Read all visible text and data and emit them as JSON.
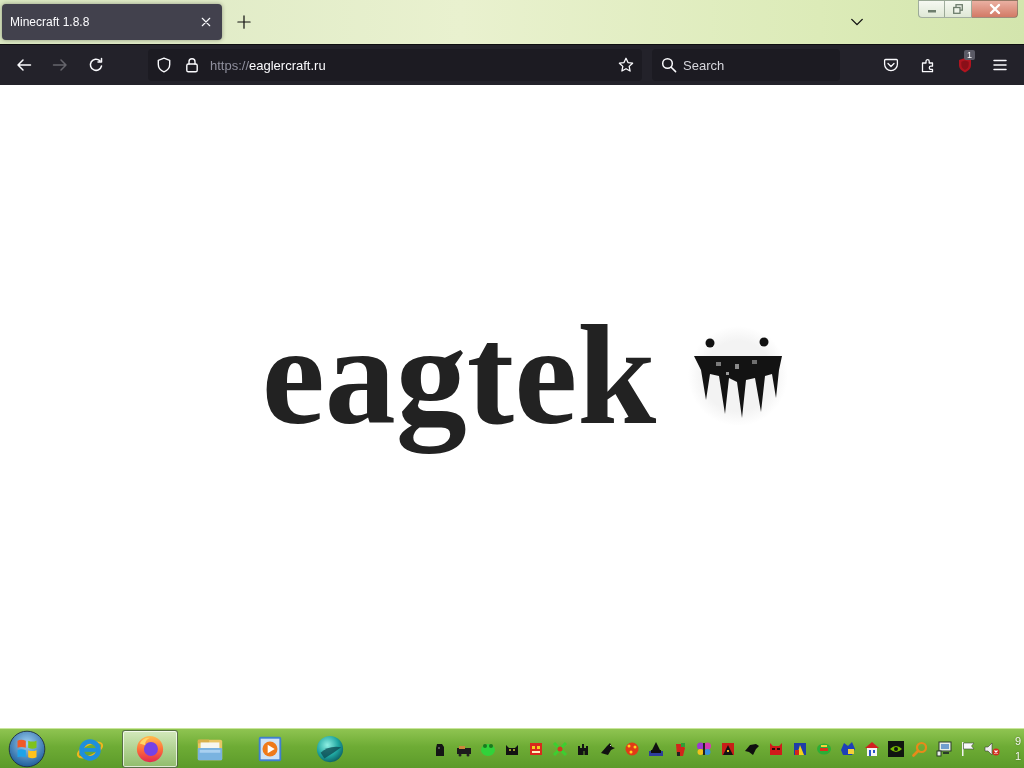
{
  "tabs": [
    {
      "title": "Minecraft 1.8.8",
      "selected": true
    }
  ],
  "toolbar": {
    "back": {
      "disabled": false
    },
    "forward": {
      "disabled": true
    },
    "address": {
      "scheme": "https://",
      "host": "eaglercraft.ru"
    },
    "search": {
      "placeholder": "Search"
    },
    "extension_badge": "1"
  },
  "page": {
    "logo": "eagtek"
  },
  "taskbar": {
    "apps": [
      {
        "kind": "web-browser",
        "selected": false
      },
      {
        "kind": "fox-browser",
        "selected": true
      },
      {
        "kind": "folder",
        "selected": false
      },
      {
        "kind": "player",
        "selected": false
      },
      {
        "kind": "sphere",
        "selected": false
      }
    ],
    "clock": {
      "time": "9",
      "date": "1"
    }
  }
}
